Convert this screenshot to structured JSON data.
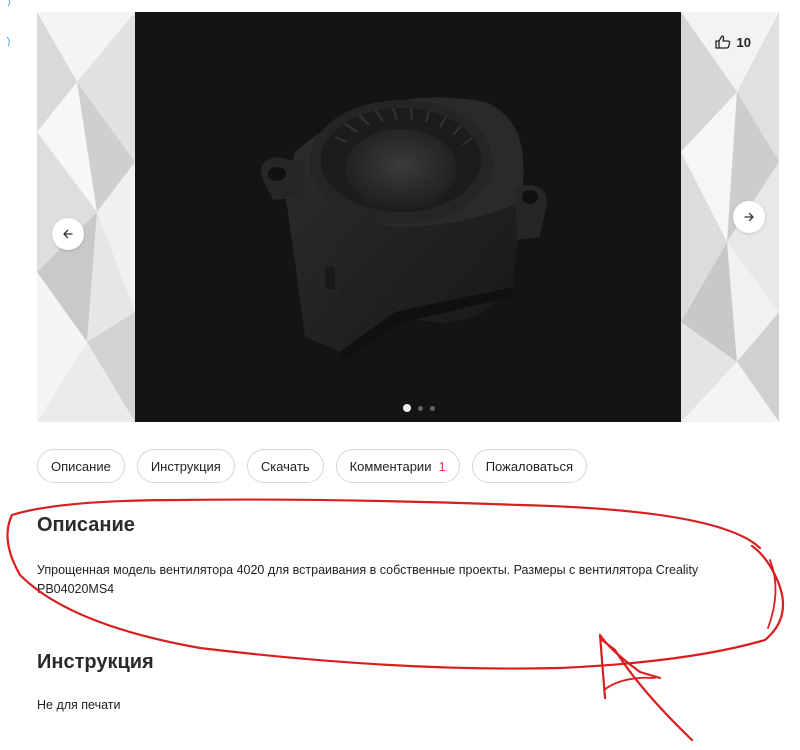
{
  "gallery": {
    "likes": "10",
    "icons": {
      "like": "thumbs-up-icon",
      "prev": "arrow-left-icon",
      "next": "arrow-right-icon"
    },
    "slides": 3,
    "active_slide": 1
  },
  "tabs": [
    {
      "label": "Описание"
    },
    {
      "label": "Инструкция"
    },
    {
      "label": "Скачать"
    },
    {
      "label": "Комментарии",
      "count": "1"
    },
    {
      "label": "Пожаловаться"
    }
  ],
  "description": {
    "title": "Описание",
    "text": "Упрощенная модель вентилятора 4020 для встраивания в собственные проекты. Размеры с вентилятора Creality PB04020MS4"
  },
  "instruction": {
    "title": "Инструкция",
    "text": "Не для печати"
  },
  "colors": {
    "accent_count": "#e8344e",
    "annotation": "#d81e1e",
    "render_bg": "#141414"
  }
}
